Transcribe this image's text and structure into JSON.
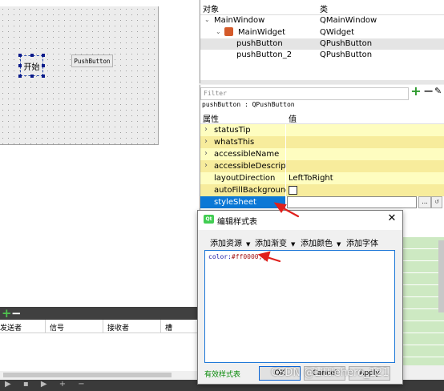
{
  "form": {
    "label_text": "开始",
    "button_text": "PushButton"
  },
  "object_inspector": {
    "col_object": "对象",
    "col_class": "类",
    "rows": [
      {
        "name": "MainWindow",
        "class": "QMainWindow"
      },
      {
        "name": "MainWidget",
        "class": "QWidget"
      },
      {
        "name": "pushButton",
        "class": "QPushButton"
      },
      {
        "name": "pushButton_2",
        "class": "QPushButton"
      }
    ]
  },
  "property_editor": {
    "filter_placeholder": "Filter",
    "title": "pushButton : QPushButton",
    "col_property": "属性",
    "col_value": "值",
    "rows": [
      {
        "name": "statusTip",
        "value": ""
      },
      {
        "name": "whatsThis",
        "value": ""
      },
      {
        "name": "accessibleName",
        "value": ""
      },
      {
        "name": "accessibleDescripti...",
        "value": ""
      },
      {
        "name": "layoutDirection",
        "value": "LeftToRight"
      },
      {
        "name": "autoFillBackground",
        "value": ""
      },
      {
        "name": "styleSheet",
        "value": ""
      }
    ],
    "dots_label": "...",
    "reset_label": "↺"
  },
  "signal_slot": {
    "col_sender": "发送者",
    "col_signal": "信号",
    "col_receiver": "接收者",
    "col_slot": "槽"
  },
  "dialog": {
    "icon_text": "Qt",
    "title": "编辑样式表",
    "menus": [
      "添加资源",
      "添加渐变",
      "添加颜色",
      "添加字体"
    ],
    "code_key": "color:",
    "code_value": "#ff0000;",
    "status": "有效样式表",
    "ok": "OK",
    "cancel": "Cancel",
    "apply": "Apply"
  },
  "watermark": "CSDN @Littlehero_121",
  "colors": {
    "selection": "#0c78d6",
    "property_bg": "#fefdc0",
    "annotation_arrow": "#e0201c"
  }
}
